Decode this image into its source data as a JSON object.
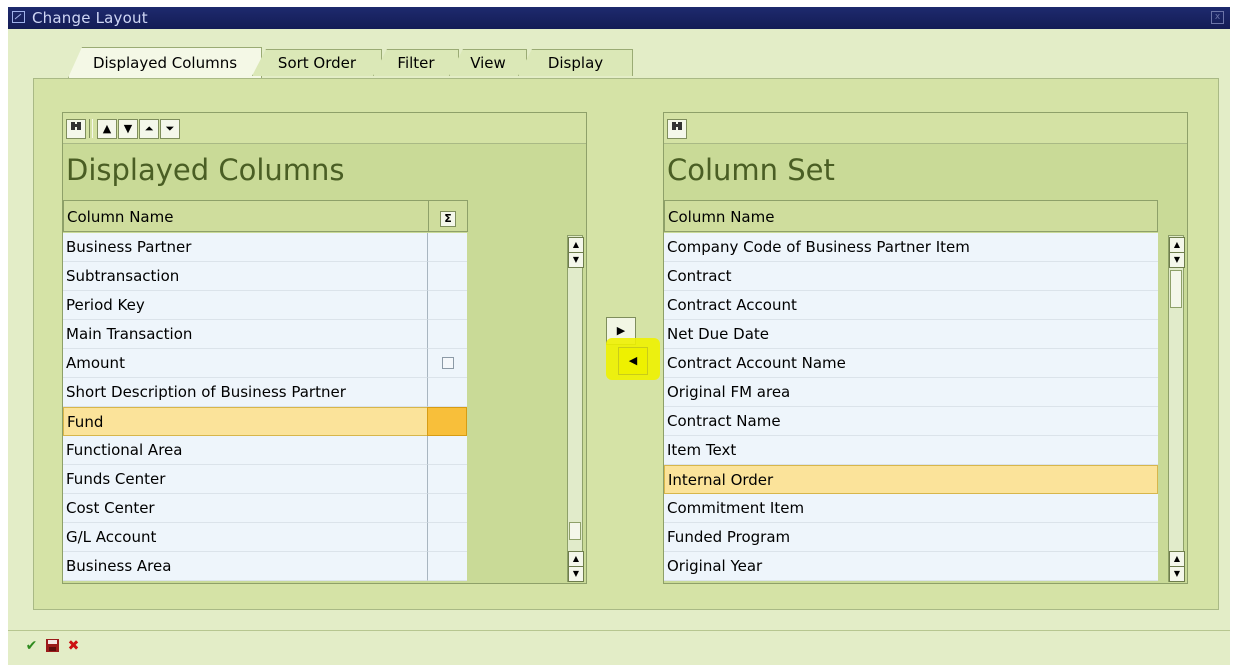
{
  "window": {
    "title": "Change Layout"
  },
  "tabs": [
    {
      "label": "Displayed Columns",
      "active": true
    },
    {
      "label": "Sort Order",
      "active": false
    },
    {
      "label": "Filter",
      "active": false
    },
    {
      "label": "View",
      "active": false
    },
    {
      "label": "Display",
      "active": false
    }
  ],
  "left_panel": {
    "title": "Displayed Columns",
    "column_header": "Column Name",
    "sum_header_icon": "sigma-icon",
    "toolbar_icons": [
      "find-icon",
      "move-up-icon",
      "move-down-icon",
      "move-top-icon",
      "move-bottom-icon"
    ],
    "rows": [
      {
        "name": "Business Partner"
      },
      {
        "name": "Subtransaction"
      },
      {
        "name": "Period Key"
      },
      {
        "name": "Main Transaction"
      },
      {
        "name": "Amount",
        "sum_checkbox": true
      },
      {
        "name": "Short Description of Business Partner"
      },
      {
        "name": "Fund",
        "selected": true
      },
      {
        "name": "Functional Area"
      },
      {
        "name": "Funds Center"
      },
      {
        "name": "Cost Center"
      },
      {
        "name": "G/L Account"
      },
      {
        "name": "Business Area"
      }
    ]
  },
  "right_panel": {
    "title": "Column Set",
    "column_header": "Column Name",
    "toolbar_icons": [
      "find-icon"
    ],
    "rows": [
      {
        "name": "Company Code of Business Partner Item"
      },
      {
        "name": "Contract"
      },
      {
        "name": "Contract Account"
      },
      {
        "name": "Net Due Date"
      },
      {
        "name": "Contract Account Name"
      },
      {
        "name": "Original FM area"
      },
      {
        "name": "Contract Name"
      },
      {
        "name": "Item Text"
      },
      {
        "name": "Internal Order",
        "selected": true
      },
      {
        "name": "Commitment Item"
      },
      {
        "name": "Funded Program"
      },
      {
        "name": "Original Year"
      }
    ]
  },
  "move_buttons": [
    {
      "icon": "arrow-right-icon"
    },
    {
      "icon": "arrow-left-icon",
      "highlighted": true,
      "highlight_color": "#eef100"
    }
  ],
  "footer_buttons": [
    {
      "icon": "checkmark-icon",
      "color": "#2e8b1e"
    },
    {
      "icon": "save-icon",
      "color": "#9b1b1b"
    },
    {
      "icon": "cancel-icon",
      "color": "#cc1111"
    }
  ],
  "colors": {
    "title_bar": "#1e2a6e",
    "dialog_bg": "#e3edc7",
    "panel_bg": "#d5e3a6",
    "row_bg": "#eef5fb",
    "selected_row": "#fbe39a",
    "selected_sum_cell": "#f8bf3a",
    "panel_title": "#4a5e24"
  }
}
